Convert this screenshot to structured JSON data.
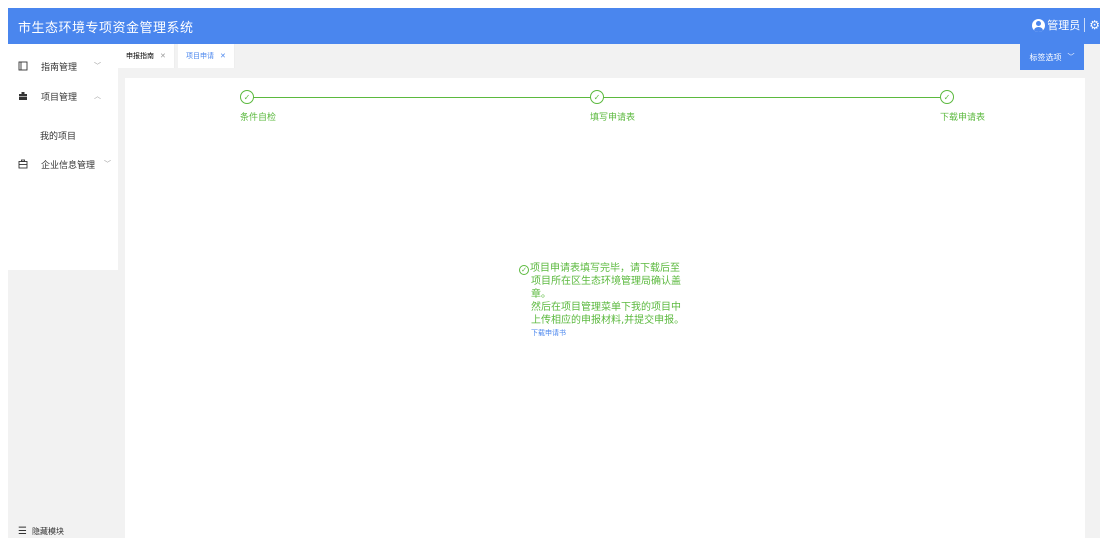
{
  "app": {
    "title": "市生态环境专项资金管理系统"
  },
  "user": {
    "name": "管理员",
    "settings_icon": "gear-icon"
  },
  "sidebar": {
    "items": [
      {
        "label": "指南管理",
        "icon": "book-icon",
        "arrow": "chevron-down"
      },
      {
        "label": "项目管理",
        "icon": "briefcase-icon",
        "arrow": "chevron-up",
        "children": [
          {
            "label": "我的项目"
          }
        ]
      },
      {
        "label": "企业信息管理",
        "icon": "building-icon",
        "arrow": "chevron-down"
      }
    ],
    "hide_module": "隐藏模块"
  },
  "tabs": [
    {
      "label": "申报指南",
      "active": false
    },
    {
      "label": "项目申请",
      "active": true
    }
  ],
  "tag_options": "标签选项",
  "steps": [
    {
      "label": "条件自检",
      "status": "done"
    },
    {
      "label": "填写申请表",
      "status": "done"
    },
    {
      "label": "下载申请表",
      "status": "done"
    }
  ],
  "message": {
    "line1": "项目申请表填写完毕，请下载后至",
    "line2": "项目所在区生态环境管理局确认盖",
    "line3": "章。",
    "line4": "然后在项目管理菜单下我的项目中",
    "line5": "上传相应的申报材料,并提交申报。",
    "download_link": "下载申请书"
  },
  "colors": {
    "primary": "#4a86ee",
    "success": "#5bb93e",
    "background": "#f2f2f2"
  }
}
